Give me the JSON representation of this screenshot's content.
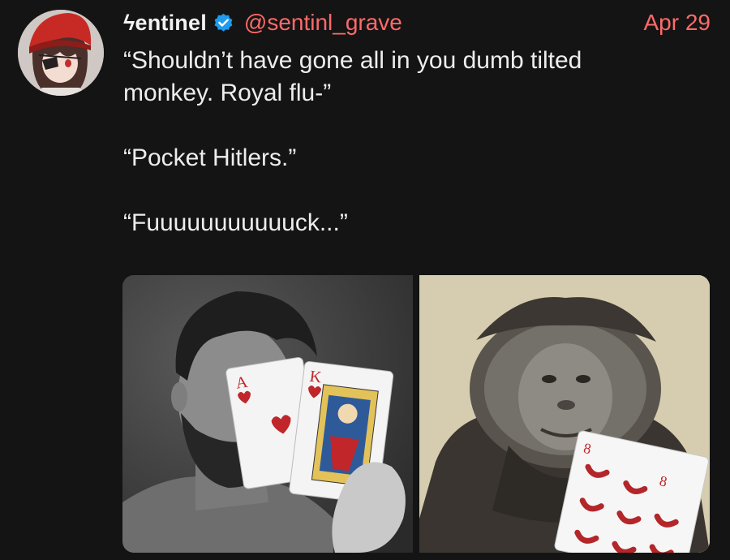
{
  "post": {
    "author": {
      "display_name": "ϟentinel",
      "verified": true,
      "handle": "@sentinl_grave"
    },
    "date": "Apr 29",
    "text_lines": [
      "“Shouldn’t have gone all in you dumb tilted",
      "monkey. Royal flu-”",
      "“Pocket Hitlers.”",
      "“Fuuuuuuuuuuuck...”"
    ],
    "media": [
      {
        "subject": "man holding ace and king playing cards",
        "cards": [
          {
            "rank": "A",
            "suit": "hearts"
          },
          {
            "rank": "K",
            "suit": "hearts"
          }
        ]
      },
      {
        "subject": "orangutan holding an eight card",
        "cards": [
          {
            "rank": "8",
            "suit": "peppers"
          }
        ]
      }
    ]
  },
  "colors": {
    "background": "#141414",
    "accent": "#ff6a6a",
    "verified": "#1d9bf0",
    "text": "#ededed"
  },
  "icons": {
    "verified": "verified-badge-icon"
  }
}
